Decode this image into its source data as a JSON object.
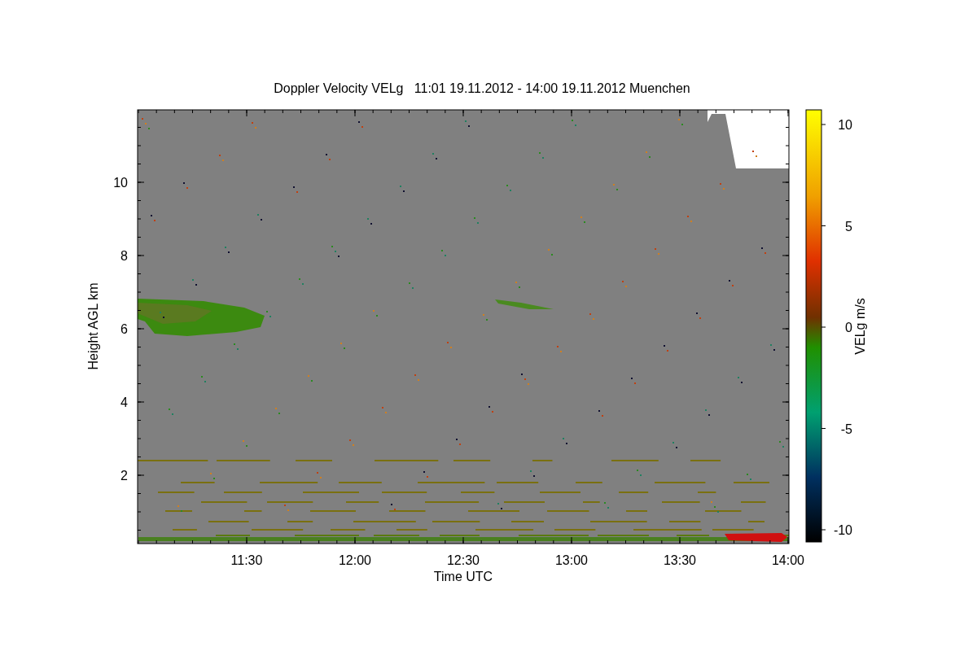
{
  "title": "Doppler Velocity VELg   11:01 19.11.2012 - 14:00 19.11.2012 Muenchen",
  "x_axis": {
    "label": "Time UTC",
    "ticks": [
      "11:30",
      "12:00",
      "12:30",
      "13:00",
      "13:30",
      "14:00"
    ]
  },
  "y_axis": {
    "label": "Height AGL km",
    "ticks": [
      "10",
      "8",
      "6",
      "4",
      "2"
    ]
  },
  "colorbar": {
    "label": "VELg m/s",
    "ticks": [
      "10",
      "5",
      "0",
      "-5",
      "-10"
    ]
  }
}
